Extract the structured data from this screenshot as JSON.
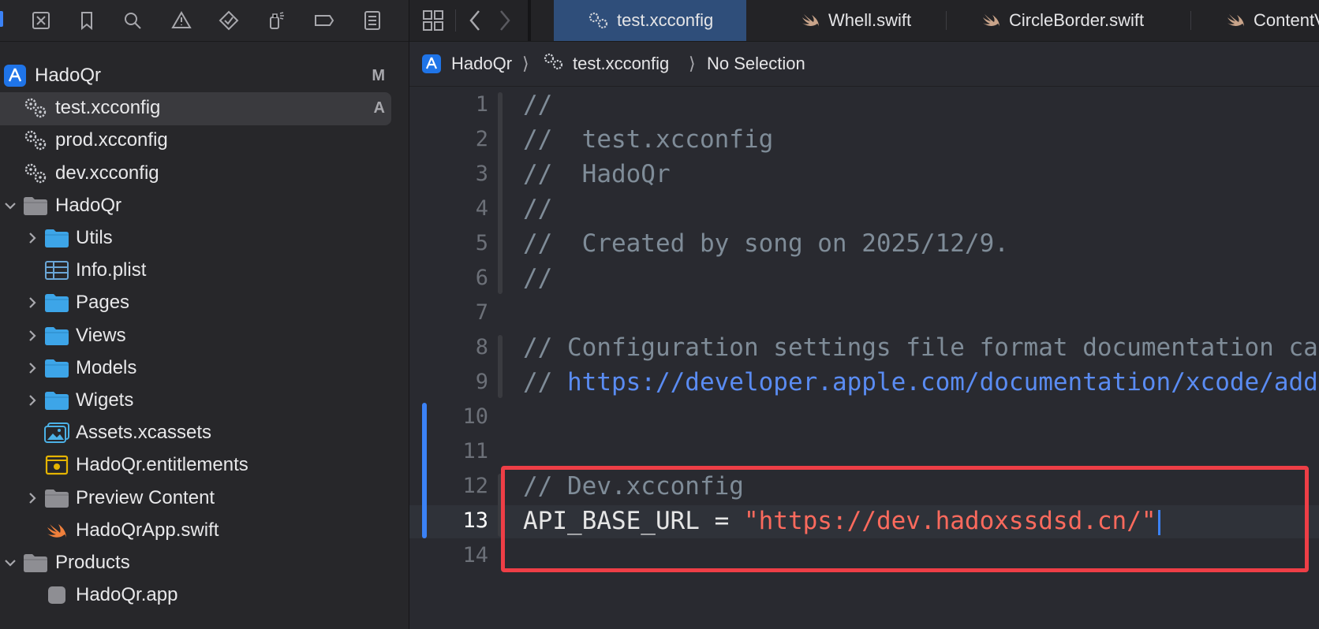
{
  "sidebar": {
    "toolbar_icons": [
      "project-navigator-icon",
      "source-control-icon",
      "bookmark-icon",
      "search-icon",
      "issue-warning-icon",
      "test-diamond-icon",
      "debug-spray-icon",
      "breakpoint-tag-icon",
      "report-list-icon"
    ],
    "tree": [
      {
        "label": "HadoQr",
        "badge": "M",
        "icon": "xcode-project-icon",
        "level": 0,
        "chevron": "none"
      },
      {
        "label": "test.xcconfig",
        "badge": "A",
        "icon": "gears-icon",
        "level": 1,
        "chevron": "none",
        "selected": true
      },
      {
        "label": "prod.xcconfig",
        "badge": "",
        "icon": "gears-icon",
        "level": 1,
        "chevron": "none"
      },
      {
        "label": "dev.xcconfig",
        "badge": "",
        "icon": "gears-icon",
        "level": 1,
        "chevron": "none"
      },
      {
        "label": "HadoQr",
        "badge": "",
        "icon": "gray-folder-icon",
        "level": 1,
        "chevron": "down"
      },
      {
        "label": "Utils",
        "badge": "",
        "icon": "blue-folder-icon",
        "level": 2,
        "chevron": "right"
      },
      {
        "label": "Info.plist",
        "badge": "",
        "icon": "plist-table-icon",
        "level": 2,
        "chevron": "none"
      },
      {
        "label": "Pages",
        "badge": "",
        "icon": "blue-folder-icon",
        "level": 2,
        "chevron": "right"
      },
      {
        "label": "Views",
        "badge": "",
        "icon": "blue-folder-icon",
        "level": 2,
        "chevron": "right"
      },
      {
        "label": "Models",
        "badge": "",
        "icon": "blue-folder-icon",
        "level": 2,
        "chevron": "right"
      },
      {
        "label": "Wigets",
        "badge": "",
        "icon": "blue-folder-icon",
        "level": 2,
        "chevron": "right"
      },
      {
        "label": "Assets.xcassets",
        "badge": "",
        "icon": "assets-icon",
        "level": 2,
        "chevron": "none"
      },
      {
        "label": "HadoQr.entitlements",
        "badge": "",
        "icon": "entitlements-icon",
        "level": 2,
        "chevron": "none"
      },
      {
        "label": "Preview Content",
        "badge": "",
        "icon": "gray-folder-icon",
        "level": 2,
        "chevron": "right"
      },
      {
        "label": "HadoQrApp.swift",
        "badge": "",
        "icon": "swift-icon",
        "level": 2,
        "chevron": "none"
      },
      {
        "label": "Products",
        "badge": "",
        "icon": "gray-folder-icon",
        "level": 1,
        "chevron": "down"
      },
      {
        "label": "HadoQr.app",
        "badge": "",
        "icon": "app-icon",
        "level": 2,
        "chevron": "none"
      }
    ]
  },
  "editor": {
    "tabs": [
      {
        "label": "test.xcconfig",
        "icon": "gears-icon",
        "active": true
      },
      {
        "label": "Whell.swift",
        "icon": "swift-icon",
        "active": false
      },
      {
        "label": "CircleBorder.swift",
        "icon": "swift-icon",
        "active": false
      },
      {
        "label": "ContentView.swift",
        "icon": "swift-icon",
        "active": false
      }
    ],
    "jumpbar": {
      "project": "HadoQr",
      "file": "test.xcconfig",
      "selection": "No Selection",
      "separator": "⟩"
    },
    "current_line": 13,
    "lines": [
      {
        "n": "1",
        "parts": [
          {
            "t": "//",
            "c": "comment"
          }
        ]
      },
      {
        "n": "2",
        "parts": [
          {
            "t": "//  test.xcconfig",
            "c": "comment"
          }
        ]
      },
      {
        "n": "3",
        "parts": [
          {
            "t": "//  HadoQr",
            "c": "comment"
          }
        ]
      },
      {
        "n": "4",
        "parts": [
          {
            "t": "//",
            "c": "comment"
          }
        ]
      },
      {
        "n": "5",
        "parts": [
          {
            "t": "//  Created by song on 2025/12/9.",
            "c": "comment"
          }
        ]
      },
      {
        "n": "6",
        "parts": [
          {
            "t": "//",
            "c": "comment"
          }
        ]
      },
      {
        "n": "7",
        "parts": []
      },
      {
        "n": "8",
        "parts": [
          {
            "t": "// Configuration settings file format documentation can be found at:",
            "c": "comment"
          }
        ]
      },
      {
        "n": "9",
        "parts": [
          {
            "t": "// ",
            "c": "comment"
          },
          {
            "t": "https://developer.apple.com/documentation/xcode/adding-a-build-configuration-file-to-your-project",
            "c": "url"
          }
        ]
      },
      {
        "n": "10",
        "parts": []
      },
      {
        "n": "11",
        "parts": []
      },
      {
        "n": "12",
        "parts": [
          {
            "t": "// Dev.xcconfig",
            "c": "comment"
          }
        ]
      },
      {
        "n": "13",
        "parts": [
          {
            "t": "API_BASE_URL = ",
            "c": "plain"
          },
          {
            "t": "\"https://dev.hadoxssdsd.cn/\"",
            "c": "string"
          }
        ]
      },
      {
        "n": "14",
        "parts": []
      }
    ]
  },
  "colors": {
    "accent": "#3b82f6",
    "highlight_border": "#ee3e46",
    "comment": "#7f8c98",
    "string": "#fc6a5d",
    "url": "#5a8cf3"
  }
}
